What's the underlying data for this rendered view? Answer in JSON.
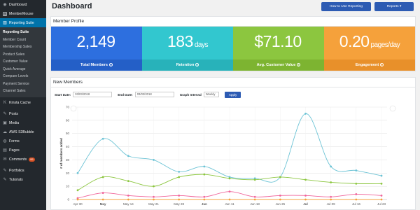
{
  "sidebar": {
    "items_top": [
      {
        "label": "Dashboard",
        "icon": "dashboard-icon"
      },
      {
        "label": "MemberMouse",
        "icon": "membermouse-icon"
      }
    ],
    "active": {
      "label": "Reporting Suite",
      "icon": "chart-icon"
    },
    "sub_items": [
      "Reporting Suite",
      "Member Count",
      "Membership Sales",
      "Product Sales",
      "Customer Value",
      "Quick Average",
      "Compare Levels",
      "Payment Service",
      "Channel Sales"
    ],
    "items_bottom": [
      {
        "label": "Kinsta Cache",
        "icon": "kinsta-icon"
      },
      {
        "label": "Posts",
        "icon": "pin-icon"
      },
      {
        "label": "Media",
        "icon": "media-icon"
      },
      {
        "label": "AWS S3Bubble",
        "icon": "cloud-icon"
      },
      {
        "label": "Forms",
        "icon": "forms-icon"
      },
      {
        "label": "Pages",
        "icon": "pages-icon"
      },
      {
        "label": "Comments",
        "icon": "comment-icon",
        "badge": "95"
      },
      {
        "label": "Portfolios",
        "icon": "portfolio-icon"
      },
      {
        "label": "Tutorials",
        "icon": "tutorial-icon"
      }
    ]
  },
  "header": {
    "title": "Dashboard",
    "how_to_label": "How to Use Reporting",
    "reports_label": "Reports ▾"
  },
  "profile": {
    "heading": "Member Profile",
    "stats": [
      {
        "value": "2,149",
        "unit": "",
        "label": "Total Members",
        "color": "#2d6fdf"
      },
      {
        "value": "183",
        "unit": "days",
        "label": "Retention",
        "color": "#32c7cf"
      },
      {
        "value": "$71.10",
        "unit": "",
        "label": "Avg. Customer Value",
        "color": "#8cc63f"
      },
      {
        "value": "0.20",
        "unit": "pages/day",
        "label": "Engagement",
        "color": "#f5a13b"
      }
    ]
  },
  "new_members": {
    "heading": "New Members",
    "start_label": "Start Date:",
    "start_value": "03/03/2018",
    "end_label": "End Date:",
    "end_value": "03/03/2018",
    "interval_label": "Graph Interval",
    "interval_value": "Weekly",
    "apply_label": "Apply"
  },
  "chart_data": {
    "type": "line",
    "ylabel": "# of members added",
    "ylim": [
      0,
      70
    ],
    "yticks": [
      0,
      10,
      20,
      30,
      40,
      50,
      60,
      70
    ],
    "grid": true,
    "x_labels": [
      "Apr 30",
      "May",
      "May 14",
      "May 21",
      "May 28",
      "Jun",
      "Jun 11",
      "Jun 18",
      "Jun 25",
      "Jul",
      "Jul 09",
      "Jul 16",
      "Jul 23"
    ],
    "series": [
      {
        "color": "#6cc3d5",
        "values": [
          20,
          46,
          33,
          30,
          21,
          25,
          17,
          16,
          17,
          65,
          25,
          22,
          18
        ]
      },
      {
        "color": "#8cc63f",
        "values": [
          7,
          17,
          14,
          10,
          17,
          19,
          16,
          15,
          17,
          15,
          13,
          12,
          12
        ]
      },
      {
        "color": "#f0649a",
        "values": [
          1,
          5,
          3,
          2,
          3,
          2,
          6,
          2,
          3,
          3,
          2,
          4,
          3
        ]
      },
      {
        "color": "#f5a13b",
        "values": [
          0,
          0,
          0,
          0,
          0,
          0,
          0,
          0,
          0,
          0,
          0,
          0,
          0
        ]
      }
    ]
  }
}
